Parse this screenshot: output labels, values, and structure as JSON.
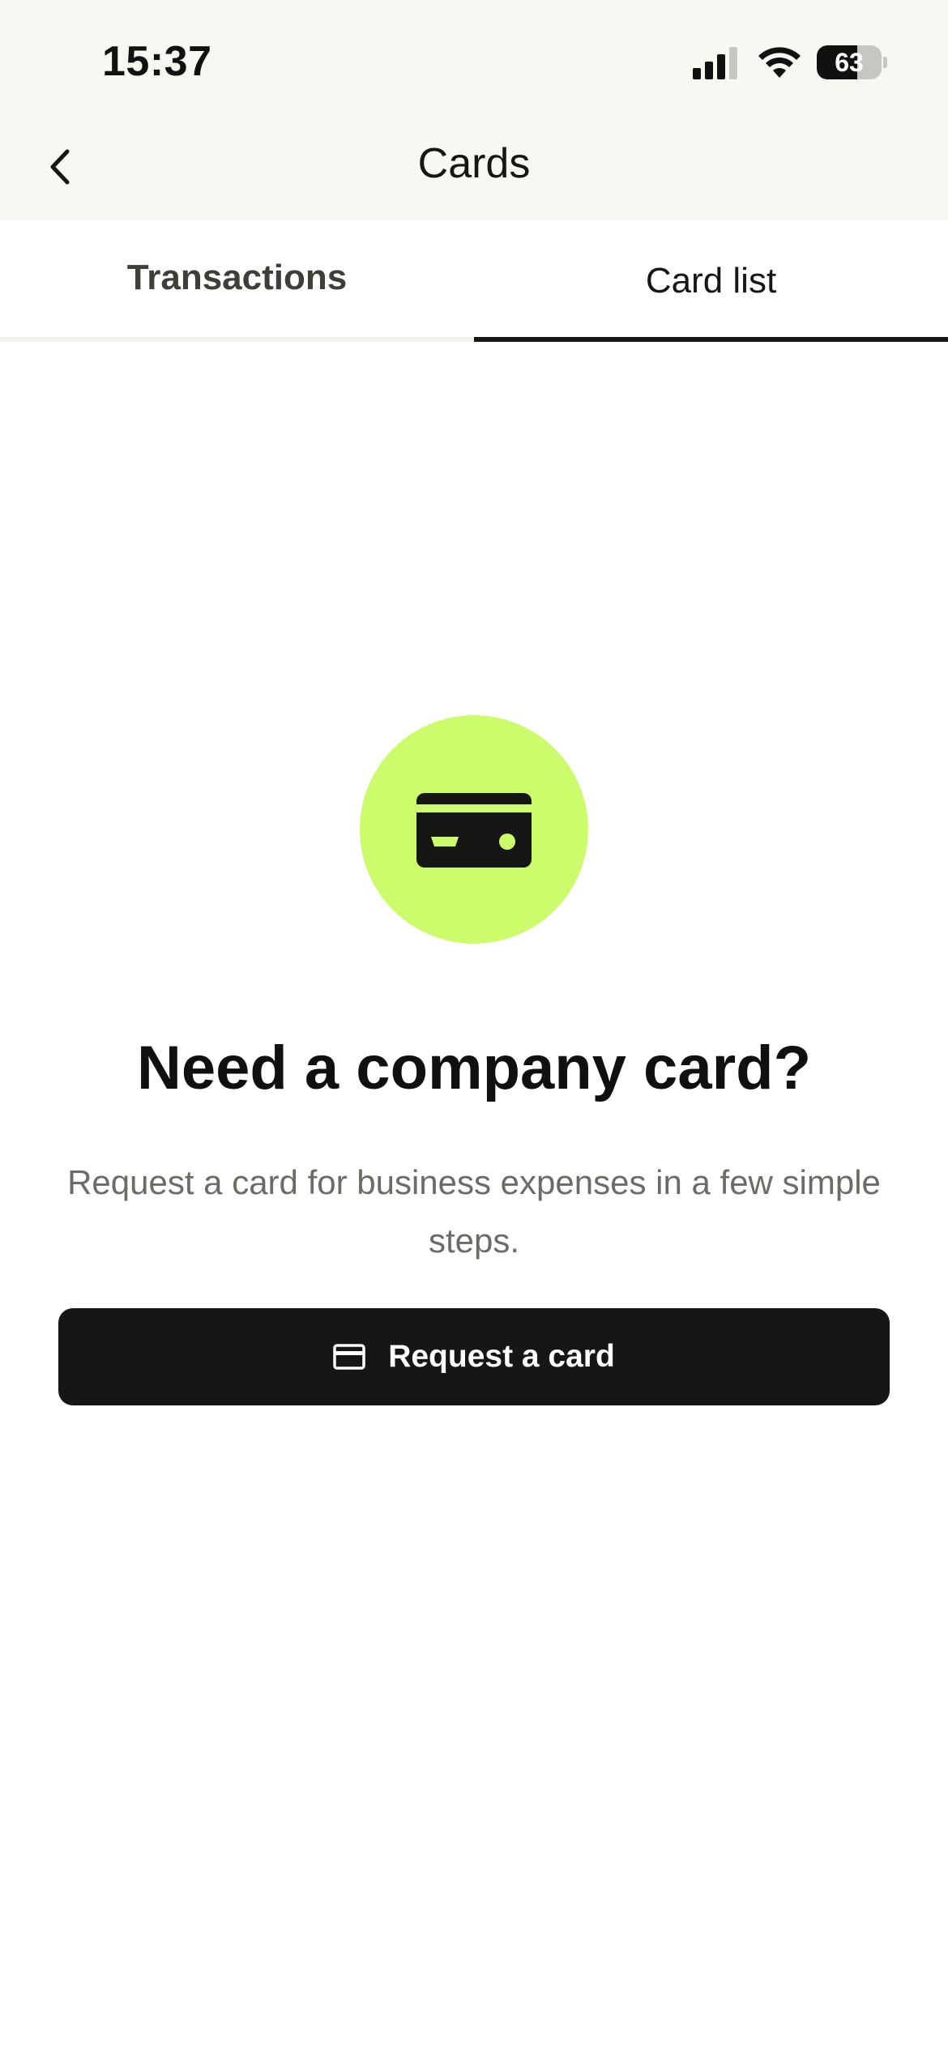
{
  "status_bar": {
    "time": "15:37",
    "battery": "63",
    "battery_level": 0.63,
    "icons": [
      "cellular-signal-icon",
      "wifi-icon",
      "battery-icon"
    ]
  },
  "nav": {
    "title": "Cards",
    "back_icon": "chevron-left-icon"
  },
  "tabs": [
    {
      "label": "Transactions",
      "active": false
    },
    {
      "label": "Card list",
      "active": true
    }
  ],
  "empty_state": {
    "icon": "credit-card-icon",
    "title": "Need a company card?",
    "description": "Request a card for business expenses in a few simple steps.",
    "button_label": "Request a card",
    "button_icon": "credit-card-icon"
  },
  "colors": {
    "accent": "#ccfc6b",
    "primary": "#161614",
    "header_bg": "#f8f8f3",
    "muted_text": "#6c6c66"
  }
}
